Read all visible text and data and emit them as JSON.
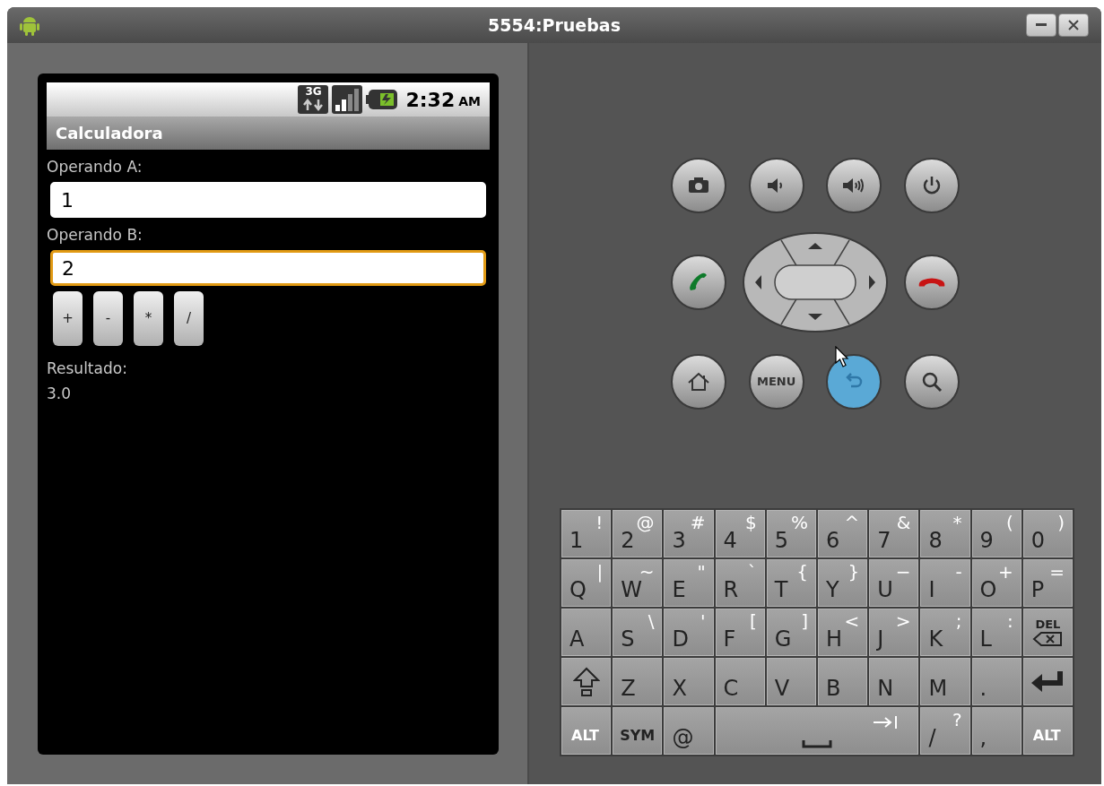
{
  "window": {
    "title": "5554:Pruebas"
  },
  "status_bar": {
    "network_type": "3G",
    "time": "2:32",
    "meridiem": "AM"
  },
  "app": {
    "title": "Calculadora",
    "fields": [
      {
        "label": "Operando A:",
        "value": "1",
        "focused": false
      },
      {
        "label": "Operando B:",
        "value": "2",
        "focused": true
      }
    ],
    "operator_buttons": [
      "+",
      "-",
      "*",
      "/"
    ],
    "result_label": "Resultado:",
    "result": "3.0"
  },
  "hardware_buttons": [
    [
      {
        "kind": "camera",
        "pressed": false
      },
      {
        "kind": "volume_down",
        "pressed": false
      },
      {
        "kind": "volume_up",
        "pressed": false
      },
      {
        "kind": "power",
        "pressed": false
      }
    ],
    [
      {
        "kind": "call",
        "pressed": false
      },
      {
        "kind": "dpad",
        "pressed": false
      },
      {
        "kind": "end_call",
        "pressed": false
      }
    ],
    [
      {
        "kind": "home",
        "pressed": false
      },
      {
        "kind": "menu",
        "label": "MENU",
        "pressed": false
      },
      {
        "kind": "back",
        "pressed": true
      },
      {
        "kind": "search",
        "pressed": false
      }
    ]
  ],
  "keyboard": [
    [
      {
        "kind": "char",
        "main": "1",
        "alt": "!"
      },
      {
        "kind": "char",
        "main": "2",
        "alt": "@"
      },
      {
        "kind": "char",
        "main": "3",
        "alt": "#"
      },
      {
        "kind": "char",
        "main": "4",
        "alt": "$"
      },
      {
        "kind": "char",
        "main": "5",
        "alt": "%"
      },
      {
        "kind": "char",
        "main": "6",
        "alt": "^"
      },
      {
        "kind": "char",
        "main": "7",
        "alt": "&"
      },
      {
        "kind": "char",
        "main": "8",
        "alt": "*"
      },
      {
        "kind": "char",
        "main": "9",
        "alt": "("
      },
      {
        "kind": "char",
        "main": "0",
        "alt": ")"
      }
    ],
    [
      {
        "kind": "char",
        "main": "Q",
        "alt": "|"
      },
      {
        "kind": "char",
        "main": "W",
        "alt": "~"
      },
      {
        "kind": "char",
        "main": "E",
        "alt": "\""
      },
      {
        "kind": "char",
        "main": "R",
        "alt": "`"
      },
      {
        "kind": "char",
        "main": "T",
        "alt": "{"
      },
      {
        "kind": "char",
        "main": "Y",
        "alt": "}"
      },
      {
        "kind": "char",
        "main": "U",
        "alt": "−"
      },
      {
        "kind": "char",
        "main": "I",
        "alt": "-"
      },
      {
        "kind": "char",
        "main": "O",
        "alt": "+"
      },
      {
        "kind": "char",
        "main": "P",
        "alt": "="
      }
    ],
    [
      {
        "kind": "char",
        "main": "A"
      },
      {
        "kind": "char",
        "main": "S",
        "alt": "\\"
      },
      {
        "kind": "char",
        "main": "D",
        "alt": "'"
      },
      {
        "kind": "char",
        "main": "F",
        "alt": "["
      },
      {
        "kind": "char",
        "main": "G",
        "alt": "]"
      },
      {
        "kind": "char",
        "main": "H",
        "alt": "<"
      },
      {
        "kind": "char",
        "main": "J",
        "alt": ">"
      },
      {
        "kind": "char",
        "main": "K",
        "alt": ";"
      },
      {
        "kind": "char",
        "main": "L",
        "alt": ":"
      },
      {
        "kind": "del",
        "main": "DEL"
      }
    ],
    [
      {
        "kind": "shift"
      },
      {
        "kind": "char",
        "main": "Z"
      },
      {
        "kind": "char",
        "main": "X"
      },
      {
        "kind": "char",
        "main": "C"
      },
      {
        "kind": "char",
        "main": "V"
      },
      {
        "kind": "char",
        "main": "B"
      },
      {
        "kind": "char",
        "main": "N"
      },
      {
        "kind": "char",
        "main": "M"
      },
      {
        "kind": "char",
        "main": "."
      },
      {
        "kind": "enter"
      }
    ],
    [
      {
        "kind": "alt",
        "main": "ALT"
      },
      {
        "kind": "sym",
        "main": "SYM"
      },
      {
        "kind": "char",
        "main": "@"
      },
      {
        "kind": "space"
      },
      {
        "kind": "char",
        "main": "/",
        "alt": "?"
      },
      {
        "kind": "char",
        "main": ","
      },
      {
        "kind": "alt",
        "main": "ALT"
      }
    ]
  ]
}
